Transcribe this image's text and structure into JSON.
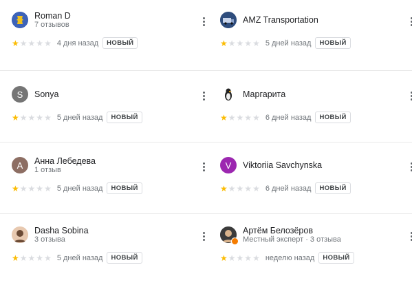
{
  "reviews": [
    {
      "name": "Roman D",
      "subtitle": "7 отзывов",
      "date": "4 дня назад",
      "badge": "НОВЫЙ",
      "rating": 1,
      "avatar": {
        "type": "image",
        "icon": "yellow-emblem-icon",
        "bg": "#3d63b8",
        "fg": "#f2c21b"
      }
    },
    {
      "name": "AMZ Transportation",
      "subtitle": "",
      "date": "5 дней назад",
      "badge": "НОВЫЙ",
      "rating": 1,
      "avatar": {
        "type": "image",
        "icon": "truck-photo-icon",
        "bg": "#2f4d7d",
        "fg": "#c8d4ea"
      }
    },
    {
      "name": "Sonya",
      "subtitle": "",
      "date": "5 дней назад",
      "badge": "НОВЫЙ",
      "rating": 1,
      "avatar": {
        "type": "letter",
        "letter": "S",
        "bg": "#757575"
      }
    },
    {
      "name": "Маргарита",
      "subtitle": "",
      "date": "6 дней назад",
      "badge": "НОВЫЙ",
      "rating": 1,
      "avatar": {
        "type": "image",
        "icon": "penguin-icon",
        "bg": "#ffffff",
        "fg": "#222222"
      }
    },
    {
      "name": "Анна Лебедева",
      "subtitle": "1 отзыв",
      "date": "5 дней назад",
      "badge": "НОВЫЙ",
      "rating": 1,
      "avatar": {
        "type": "letter",
        "letter": "А",
        "bg": "#8d6e63"
      }
    },
    {
      "name": "Viktoriia Savchynska",
      "subtitle": "",
      "date": "6 дней назад",
      "badge": "НОВЫЙ",
      "rating": 1,
      "avatar": {
        "type": "letter",
        "letter": "V",
        "bg": "#9c27b0"
      }
    },
    {
      "name": "Dasha Sobina",
      "subtitle": "3 отзыва",
      "date": "5 дней назад",
      "badge": "НОВЫЙ",
      "rating": 1,
      "avatar": {
        "type": "image",
        "icon": "portrait-photo-icon",
        "bg": "#e8c9b0",
        "fg": "#6b4a35"
      }
    },
    {
      "name": "Артём Белозёров",
      "subtitle": "Местный эксперт · 3 отзыва",
      "date": "неделю назад",
      "badge": "НОВЫЙ",
      "rating": 1,
      "avatar": {
        "type": "image",
        "icon": "portrait-photo-icon",
        "bg": "#3b3b3b",
        "fg": "#d9b38c",
        "badge_color": "#f57c00"
      }
    }
  ],
  "colors": {
    "star_on": "#fbbc04",
    "star_off": "#dadce0",
    "divider": "#e8e8e8"
  },
  "max_rating": 5
}
